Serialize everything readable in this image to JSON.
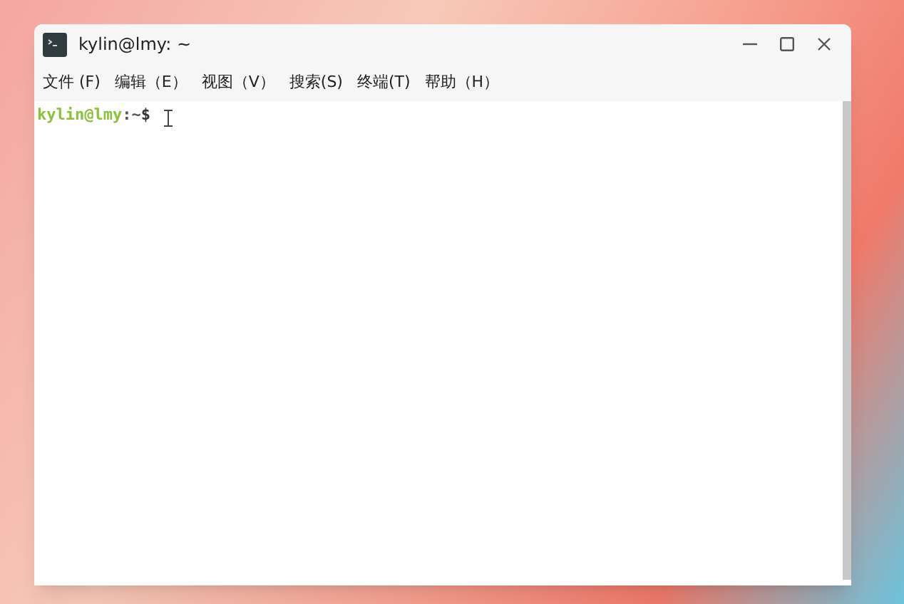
{
  "window": {
    "title": "kylin@lmy: ~"
  },
  "menu": [
    {
      "label": "文件 (F)"
    },
    {
      "label": "编辑（E）"
    },
    {
      "label": "视图（V）"
    },
    {
      "label": "搜索(S)"
    },
    {
      "label": "终端(T)"
    },
    {
      "label": "帮助（H）"
    }
  ],
  "terminal": {
    "prompt_user": "kylin@lmy",
    "prompt_path": ":~",
    "prompt_symbol": "$"
  }
}
